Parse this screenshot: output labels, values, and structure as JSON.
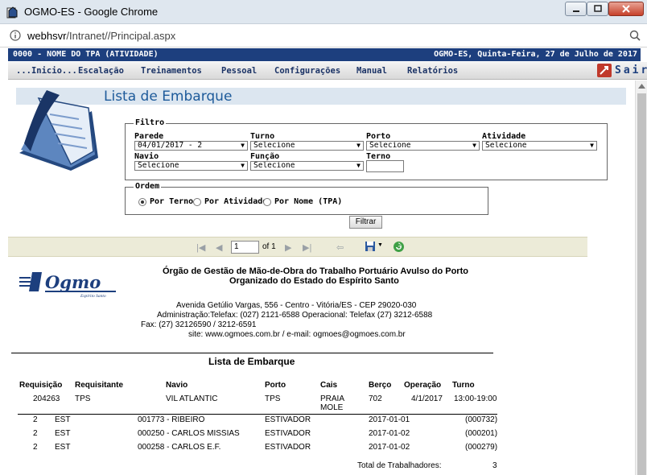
{
  "window": {
    "title": "OGMO-ES - Google Chrome",
    "url_host": "webhsvr",
    "url_path": "/Intranet//Principal.aspx"
  },
  "header": {
    "tpa": "0000 - NOME DO TPA (ATIVIDADE)",
    "location_date": "OGMO-ES, Quinta-Feira, 27 de Julho de 2017"
  },
  "menu": {
    "items": [
      "...Inicio...",
      "Escalação",
      "Treinamentos",
      "Pessoal",
      "Configurações",
      "Manual",
      "Relatórios"
    ],
    "exit": "Sair"
  },
  "page": {
    "title": "Lista de Embarque"
  },
  "filtro": {
    "legend": "Filtro",
    "parede_label": "Parede",
    "parede_value": "04/01/2017 - 2",
    "turno_label": "Turno",
    "turno_value": "Selecione",
    "porto_label": "Porto",
    "porto_value": "Selecione",
    "atividade_label": "Atividade",
    "atividade_value": "Selecione",
    "navio_label": "Navio",
    "navio_value": "Selecione",
    "funcao_label": "Função",
    "funcao_value": "Selecione",
    "terno_label": "Terno",
    "terno_value": ""
  },
  "ordem": {
    "legend": "Ordem",
    "options": [
      "Por Terno",
      "Por Atividade",
      "Por Nome (TPA)"
    ],
    "selected": "Por Terno"
  },
  "filtrar_button": "Filtrar",
  "toolbar": {
    "page": "1",
    "of": "of 1"
  },
  "report": {
    "org_line1": "Órgão de Gestão de Mão-de-Obra do Trabalho Portuário Avulso do Porto",
    "org_line2": "Organizado do Estado do Espírito Santo",
    "address": "Avenida Getúlio Vargas, 556 - Centro - Vitória/ES - CEP 29020-030",
    "phones": "Administração:Telefax: (027) 2121-6588  Operacional: Telefax (27) 3212-6588",
    "fax": "Fax: (27) 32126590 / 3212-6591",
    "site": "site: www.ogmoes.com.br / e-mail: ogmoes@ogmoes.com.br",
    "logo_text": "Ogmo",
    "logo_sub": "Espírito Santo",
    "list_title": "Lista de Embarque",
    "headers": {
      "requisicao": "Requisição",
      "requisitante": "Requisitante",
      "navio": "Navio",
      "porto": "Porto",
      "cais": "Cais",
      "berco": "Berço",
      "operacao": "Operação",
      "turno": "Turno"
    },
    "requisition": {
      "requisicao": "204263",
      "requisitante": "TPS",
      "navio": "VIL ATLANTIC",
      "porto": "TPS",
      "cais_line1": "PRAIA",
      "cais_line2": "MOLE",
      "berco": "702",
      "operacao": "4/1/2017",
      "turno": "13:00-19:00"
    },
    "workers": [
      {
        "qty": "2",
        "type": "EST",
        "name": "001773 - RIBEIRO",
        "role": "ESTIVADOR",
        "date": "2017-01-01",
        "code": "(000732)"
      },
      {
        "qty": "2",
        "type": "EST",
        "name": "000250 - CARLOS MISSIAS",
        "role": "ESTIVADOR",
        "date": "2017-01-02",
        "code": "(000201)"
      },
      {
        "qty": "2",
        "type": "EST",
        "name": "000258 - CARLOS E.F.",
        "role": "ESTIVADOR",
        "date": "2017-01-02",
        "code": "(000279)"
      }
    ],
    "total_label": "Total de Trabalhadores:",
    "total_value": "3"
  },
  "colors": {
    "brand": "#1d3f7e",
    "title": "#1d5a9a",
    "band": "#dce6f0",
    "toolbar": "#ecebd8"
  }
}
